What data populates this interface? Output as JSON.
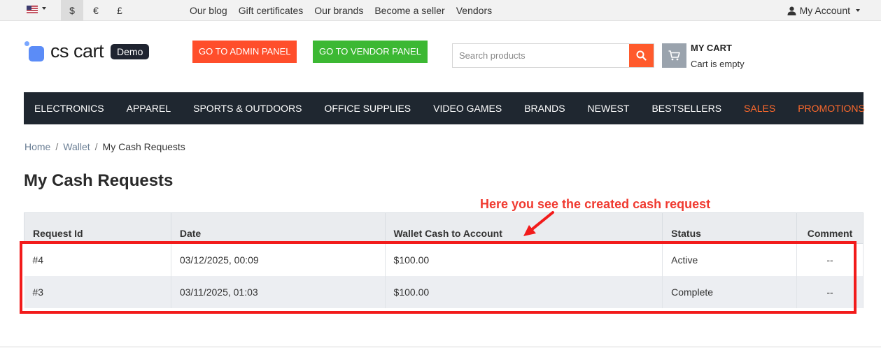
{
  "topbar": {
    "currencies": [
      {
        "symbol": "$",
        "active": true
      },
      {
        "symbol": "€",
        "active": false
      },
      {
        "symbol": "£",
        "active": false
      }
    ],
    "links": [
      "Our blog",
      "Gift certificates",
      "Our brands",
      "Become a seller",
      "Vendors"
    ],
    "account_label": "My Account"
  },
  "header": {
    "logo_text": "cs cart",
    "logo_badge": "Demo",
    "admin_button": "GO TO ADMIN PANEL",
    "vendor_button": "GO TO VENDOR PANEL",
    "search_placeholder": "Search products",
    "cart_title": "MY CART",
    "cart_status": "Cart is empty"
  },
  "nav": {
    "items": [
      {
        "label": "ELECTRONICS",
        "highlight": false
      },
      {
        "label": "APPAREL",
        "highlight": false
      },
      {
        "label": "SPORTS & OUTDOORS",
        "highlight": false
      },
      {
        "label": "OFFICE SUPPLIES",
        "highlight": false
      },
      {
        "label": "VIDEO GAMES",
        "highlight": false
      },
      {
        "label": "BRANDS",
        "highlight": false
      },
      {
        "label": "NEWEST",
        "highlight": false
      },
      {
        "label": "BESTSELLERS",
        "highlight": false
      },
      {
        "label": "SALES",
        "highlight": true
      },
      {
        "label": "PROMOTIONS",
        "highlight": true
      }
    ]
  },
  "breadcrumb": {
    "home": "Home",
    "wallet": "Wallet",
    "current": "My Cash Requests",
    "separator": "/"
  },
  "page_title": "My Cash Requests",
  "table": {
    "headers": [
      "Request Id",
      "Date",
      "Wallet Cash to Account",
      "Status",
      "Comment"
    ],
    "rows": [
      [
        "#4",
        "03/12/2025, 00:09",
        "$100.00",
        "Active",
        "--"
      ],
      [
        "#3",
        "03/11/2025, 01:03",
        "$100.00",
        "Complete",
        "--"
      ]
    ]
  },
  "annotation": {
    "text": "Here you see the created cash request"
  },
  "colors": {
    "admin_button": "#ff4e2b",
    "vendor_button": "#3cb833",
    "nav_bg": "#1f2730",
    "nav_highlight": "#ff6a2c",
    "annotation": "#f21b1b"
  }
}
